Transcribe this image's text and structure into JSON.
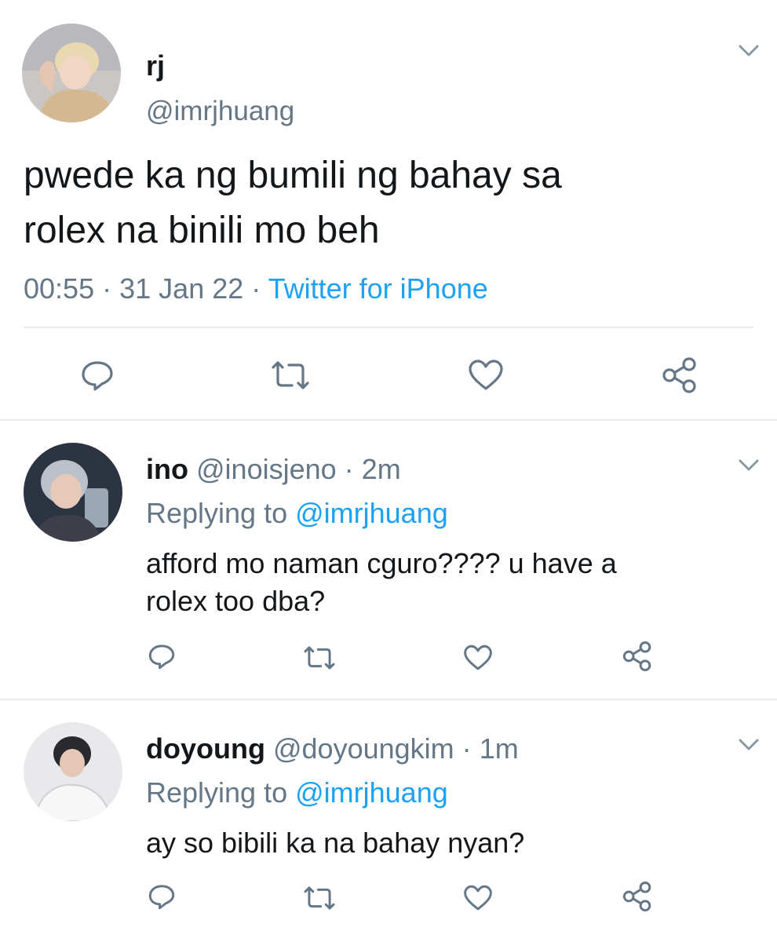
{
  "main_tweet": {
    "display_name": "rj",
    "handle": "@imrjhuang",
    "text_line1": "pwede ka ng bumili ng bahay sa",
    "text_line2": "rolex na binili mo beh",
    "time": "00:55",
    "sep1": "·",
    "date": "31 Jan 22",
    "sep2": "·",
    "source": "Twitter for iPhone"
  },
  "replies": [
    {
      "display_name": "ino",
      "handle": "@inoisjeno",
      "sep": "·",
      "age": "2m",
      "replying_label": "Replying to",
      "replying_handle": "@imrjhuang",
      "text_line1": "afford mo naman cguro???? u have a",
      "text_line2": "rolex too dba?"
    },
    {
      "display_name": "doyoung",
      "handle": "@doyoungkim",
      "sep": "·",
      "age": "1m",
      "replying_label": "Replying to",
      "replying_handle": "@imrjhuang",
      "text_line1": "ay so bibili ka na bahay nyan?"
    }
  ],
  "icons": [
    "chevron-down-icon",
    "reply-icon",
    "retweet-icon",
    "like-icon",
    "share-icon"
  ],
  "colors": {
    "link_blue": "#1da1f2",
    "secondary_text": "#657786",
    "icon_grey": "#657786",
    "divider": "#e6ecf0"
  }
}
